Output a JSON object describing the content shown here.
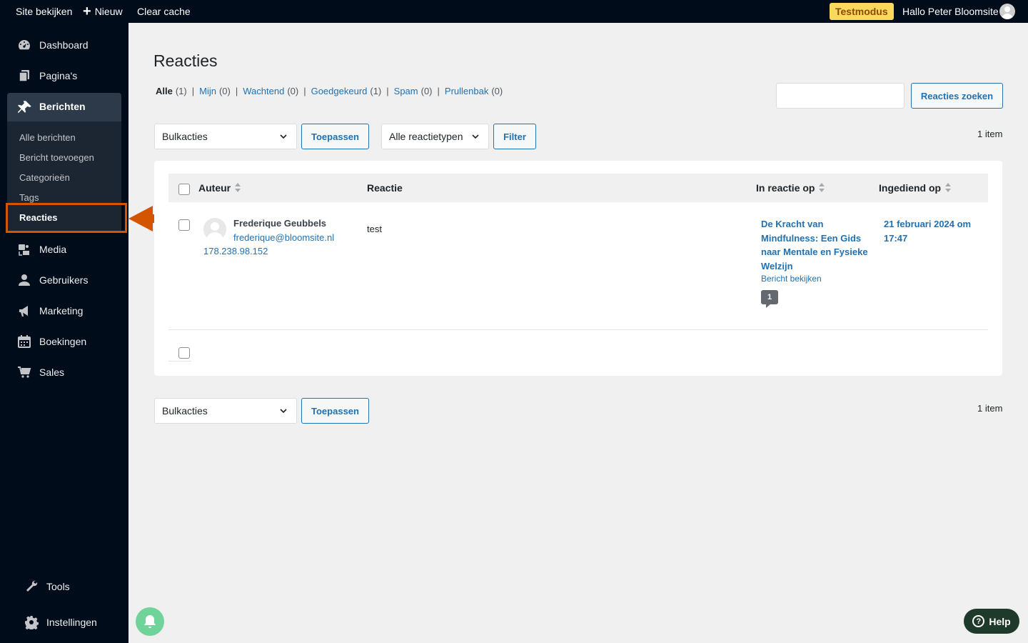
{
  "adminbar": {
    "site_link": "Site bekijken",
    "new_label": "Nieuw",
    "clear_cache": "Clear cache",
    "testmode_badge": "Testmodus",
    "greeting": "Hallo Peter Bloomsite"
  },
  "sidebar": {
    "items": [
      {
        "label": "Dashboard",
        "icon": "dashboard-icon"
      },
      {
        "label": "Pagina's",
        "icon": "pages-icon"
      },
      {
        "label": "Berichten",
        "icon": "pin-icon"
      },
      {
        "label": "Media",
        "icon": "media-icon"
      },
      {
        "label": "Gebruikers",
        "icon": "users-icon"
      },
      {
        "label": "Marketing",
        "icon": "megaphone-icon"
      },
      {
        "label": "Boekingen",
        "icon": "calendar-icon"
      },
      {
        "label": "Sales",
        "icon": "cart-icon"
      }
    ],
    "submenu": [
      "Alle berichten",
      "Bericht toevoegen",
      "Categorieën",
      "Tags",
      "Reacties"
    ],
    "bottom": [
      {
        "label": "Tools",
        "icon": "wrench-icon"
      },
      {
        "label": "Instellingen",
        "icon": "gear-icon"
      }
    ]
  },
  "main": {
    "title": "Reacties",
    "filters": [
      {
        "label": "Alle",
        "count": "(1)"
      },
      {
        "label": "Mijn",
        "count": "(0)"
      },
      {
        "label": "Wachtend",
        "count": "(0)"
      },
      {
        "label": "Goedgekeurd",
        "count": "(1)"
      },
      {
        "label": "Spam",
        "count": "(0)"
      },
      {
        "label": "Prullenbak",
        "count": "(0)"
      }
    ],
    "search": {
      "placeholder": "",
      "button": "Reacties zoeken"
    },
    "bulk_actions": "Bulkacties",
    "apply": "Toepassen",
    "comment_type": "Alle reactietypen",
    "filter": "Filter",
    "item_count": "1 item",
    "columns": [
      "Auteur",
      "Reactie",
      "In reactie op",
      "Ingediend op"
    ],
    "rows": [
      {
        "author": "Frederique Geubbels",
        "email": "frederique@bloomsite.nl",
        "ip": "178.238.98.152",
        "comment": "test",
        "post_title": "De Kracht van Mindfulness: Een Gids naar Mentale en Fysieke Welzijn",
        "view_post": "Bericht bekijken",
        "comment_count": "1",
        "submitted": "21 februari 2024 om 17:47"
      }
    ]
  },
  "help_button": "Help",
  "colors": {
    "accent": "#2271b1",
    "sidebar": "#000c1a",
    "highlight": "#d45500",
    "badge": "#fcd85c"
  }
}
